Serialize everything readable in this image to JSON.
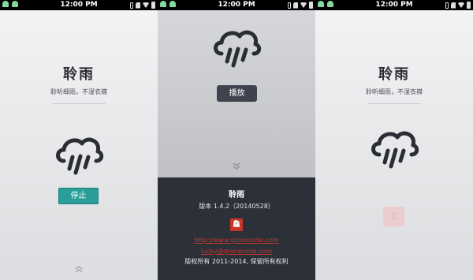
{
  "statusbar": {
    "time": "12:00 PM"
  },
  "screen_playing": {
    "title": "聆雨",
    "subtitle": "聆听细雨，不湿衣襟",
    "stop_label": "停止"
  },
  "screen_about": {
    "play_label": "播放",
    "app_name": "聆雨",
    "version": "版本 1.4.2（20140528）",
    "logo_text": "鱻",
    "link_website": "http://www.grocecode.com",
    "link_email": "lucky@grocecode.com",
    "copyright": "版权所有 2011-2014, 保留所有权利"
  },
  "screen_idle": {
    "title": "聆雨",
    "subtitle": "聆听细雨，不湿衣襟",
    "faded_button_glyph": "♫"
  },
  "icons": [
    "android-icon",
    "usb-icon",
    "sdcard-icon",
    "wifi-icon",
    "battery-icon",
    "rain-cloud-icon",
    "chevron-up-icon",
    "chevron-down-icon"
  ],
  "colors": {
    "accent_teal": "#2a9e9a",
    "dark_panel": "#2c3039",
    "link_red": "#c0392b",
    "logo_red": "#c8342a"
  }
}
